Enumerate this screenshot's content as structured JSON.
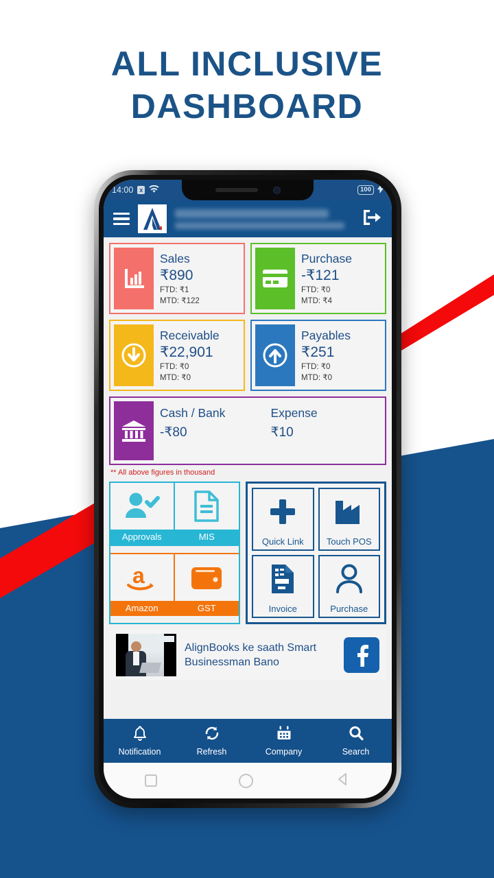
{
  "headline": {
    "line1": "ALL INCLUSIVE",
    "line2": "DASHBOARD"
  },
  "colors": {
    "brand_blue": "#14508A",
    "headline_blue": "#1B5387",
    "accent_red": "#F40A0A",
    "sales": "#F4706A",
    "purchase": "#5CBF2A",
    "receivable": "#F4B81B",
    "payables": "#2B78BE",
    "cashbank": "#8E2E9B",
    "cyan": "#27B6D4",
    "orange": "#F4740C",
    "navy": "#17568F"
  },
  "statusbar": {
    "time": "14:00",
    "close_badge": "x",
    "wifi_icon": "wifi-icon",
    "battery_level": "100",
    "charging_icon": "charging-bolt-icon"
  },
  "appbar": {
    "menu_icon": "hamburger-menu-icon",
    "logo_icon": "alignbooks-logo-icon",
    "company_line": "",
    "period_line": "",
    "logout_icon": "logout-icon"
  },
  "kpi_cards": [
    {
      "title": "Sales",
      "amount": "₹890",
      "ftd": "FTD: ₹1",
      "mtd": "MTD: ₹122",
      "color": "#F4706A",
      "icon": "bar-chart-icon"
    },
    {
      "title": "Purchase",
      "amount": "-₹121",
      "ftd": "FTD: ₹0",
      "mtd": "MTD: ₹4",
      "color": "#5CBF2A",
      "icon": "credit-card-icon"
    },
    {
      "title": "Receivable",
      "amount": "₹22,901",
      "ftd": "FTD: ₹0",
      "mtd": "MTD: ₹0",
      "color": "#F4B81B",
      "icon": "arrow-down-circle-icon"
    },
    {
      "title": "Payables",
      "amount": "₹251",
      "ftd": "FTD: ₹0",
      "mtd": "MTD: ₹0",
      "color": "#2B78BE",
      "icon": "arrow-up-circle-icon"
    }
  ],
  "kpi_wide": {
    "icon": "bank-icon",
    "color": "#8E2E9B",
    "cash_title": "Cash / Bank",
    "cash_amount": "-₹80",
    "expense_title": "Expense",
    "expense_amount": "₹10"
  },
  "footnote": "** All above figures in thousand",
  "tiles_left": [
    {
      "label": "Approvals",
      "icon": "user-check-icon",
      "theme": "cyan"
    },
    {
      "label": "MIS",
      "icon": "document-lines-icon",
      "theme": "cyan"
    },
    {
      "label": "Amazon",
      "icon": "amazon-icon",
      "theme": "orange"
    },
    {
      "label": "GST",
      "icon": "wallet-icon",
      "theme": "orange"
    }
  ],
  "tiles_right": [
    {
      "label": "Quick Link",
      "icon": "plus-icon"
    },
    {
      "label": "Touch POS",
      "icon": "factory-icon"
    },
    {
      "label": "Invoice",
      "icon": "invoice-document-icon"
    },
    {
      "label": "Purchase",
      "icon": "person-icon"
    }
  ],
  "banner": {
    "thumb_icon": "video-thumbnail",
    "text": "AlignBooks ke saath Smart Businessman Bano",
    "facebook_icon": "facebook-icon"
  },
  "bottom_nav": [
    {
      "label": "Notification",
      "icon": "bell-icon"
    },
    {
      "label": "Refresh",
      "icon": "refresh-icon"
    },
    {
      "label": "Company",
      "icon": "calendar-icon"
    },
    {
      "label": "Search",
      "icon": "search-icon"
    }
  ],
  "android_nav": [
    {
      "name": "recents-button",
      "icon": "square-icon"
    },
    {
      "name": "home-button",
      "icon": "circle-icon"
    },
    {
      "name": "back-button",
      "icon": "triangle-back-icon"
    }
  ]
}
